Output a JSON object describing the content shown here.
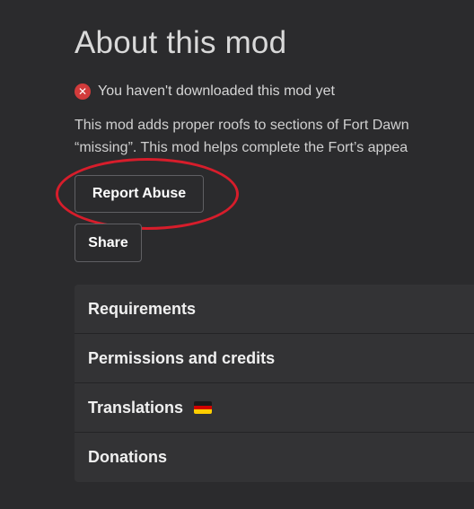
{
  "page_title": "About this mod",
  "download_status": {
    "icon": "x-circle-icon",
    "icon_color": "#d23b3b",
    "text": "You haven't downloaded this mod yet"
  },
  "description": {
    "line1": "This mod adds proper roofs to sections of Fort Dawn",
    "line2": "“missing”. This mod helps complete the Fort’s appea"
  },
  "buttons": {
    "report_abuse": "Report Abuse",
    "share": "Share"
  },
  "annotation": {
    "color": "#d71d2b"
  },
  "accordion": {
    "items": [
      {
        "label": "Requirements"
      },
      {
        "label": "Permissions and credits"
      },
      {
        "label": "Translations",
        "flag": "german-flag-icon"
      },
      {
        "label": "Donations"
      }
    ]
  }
}
